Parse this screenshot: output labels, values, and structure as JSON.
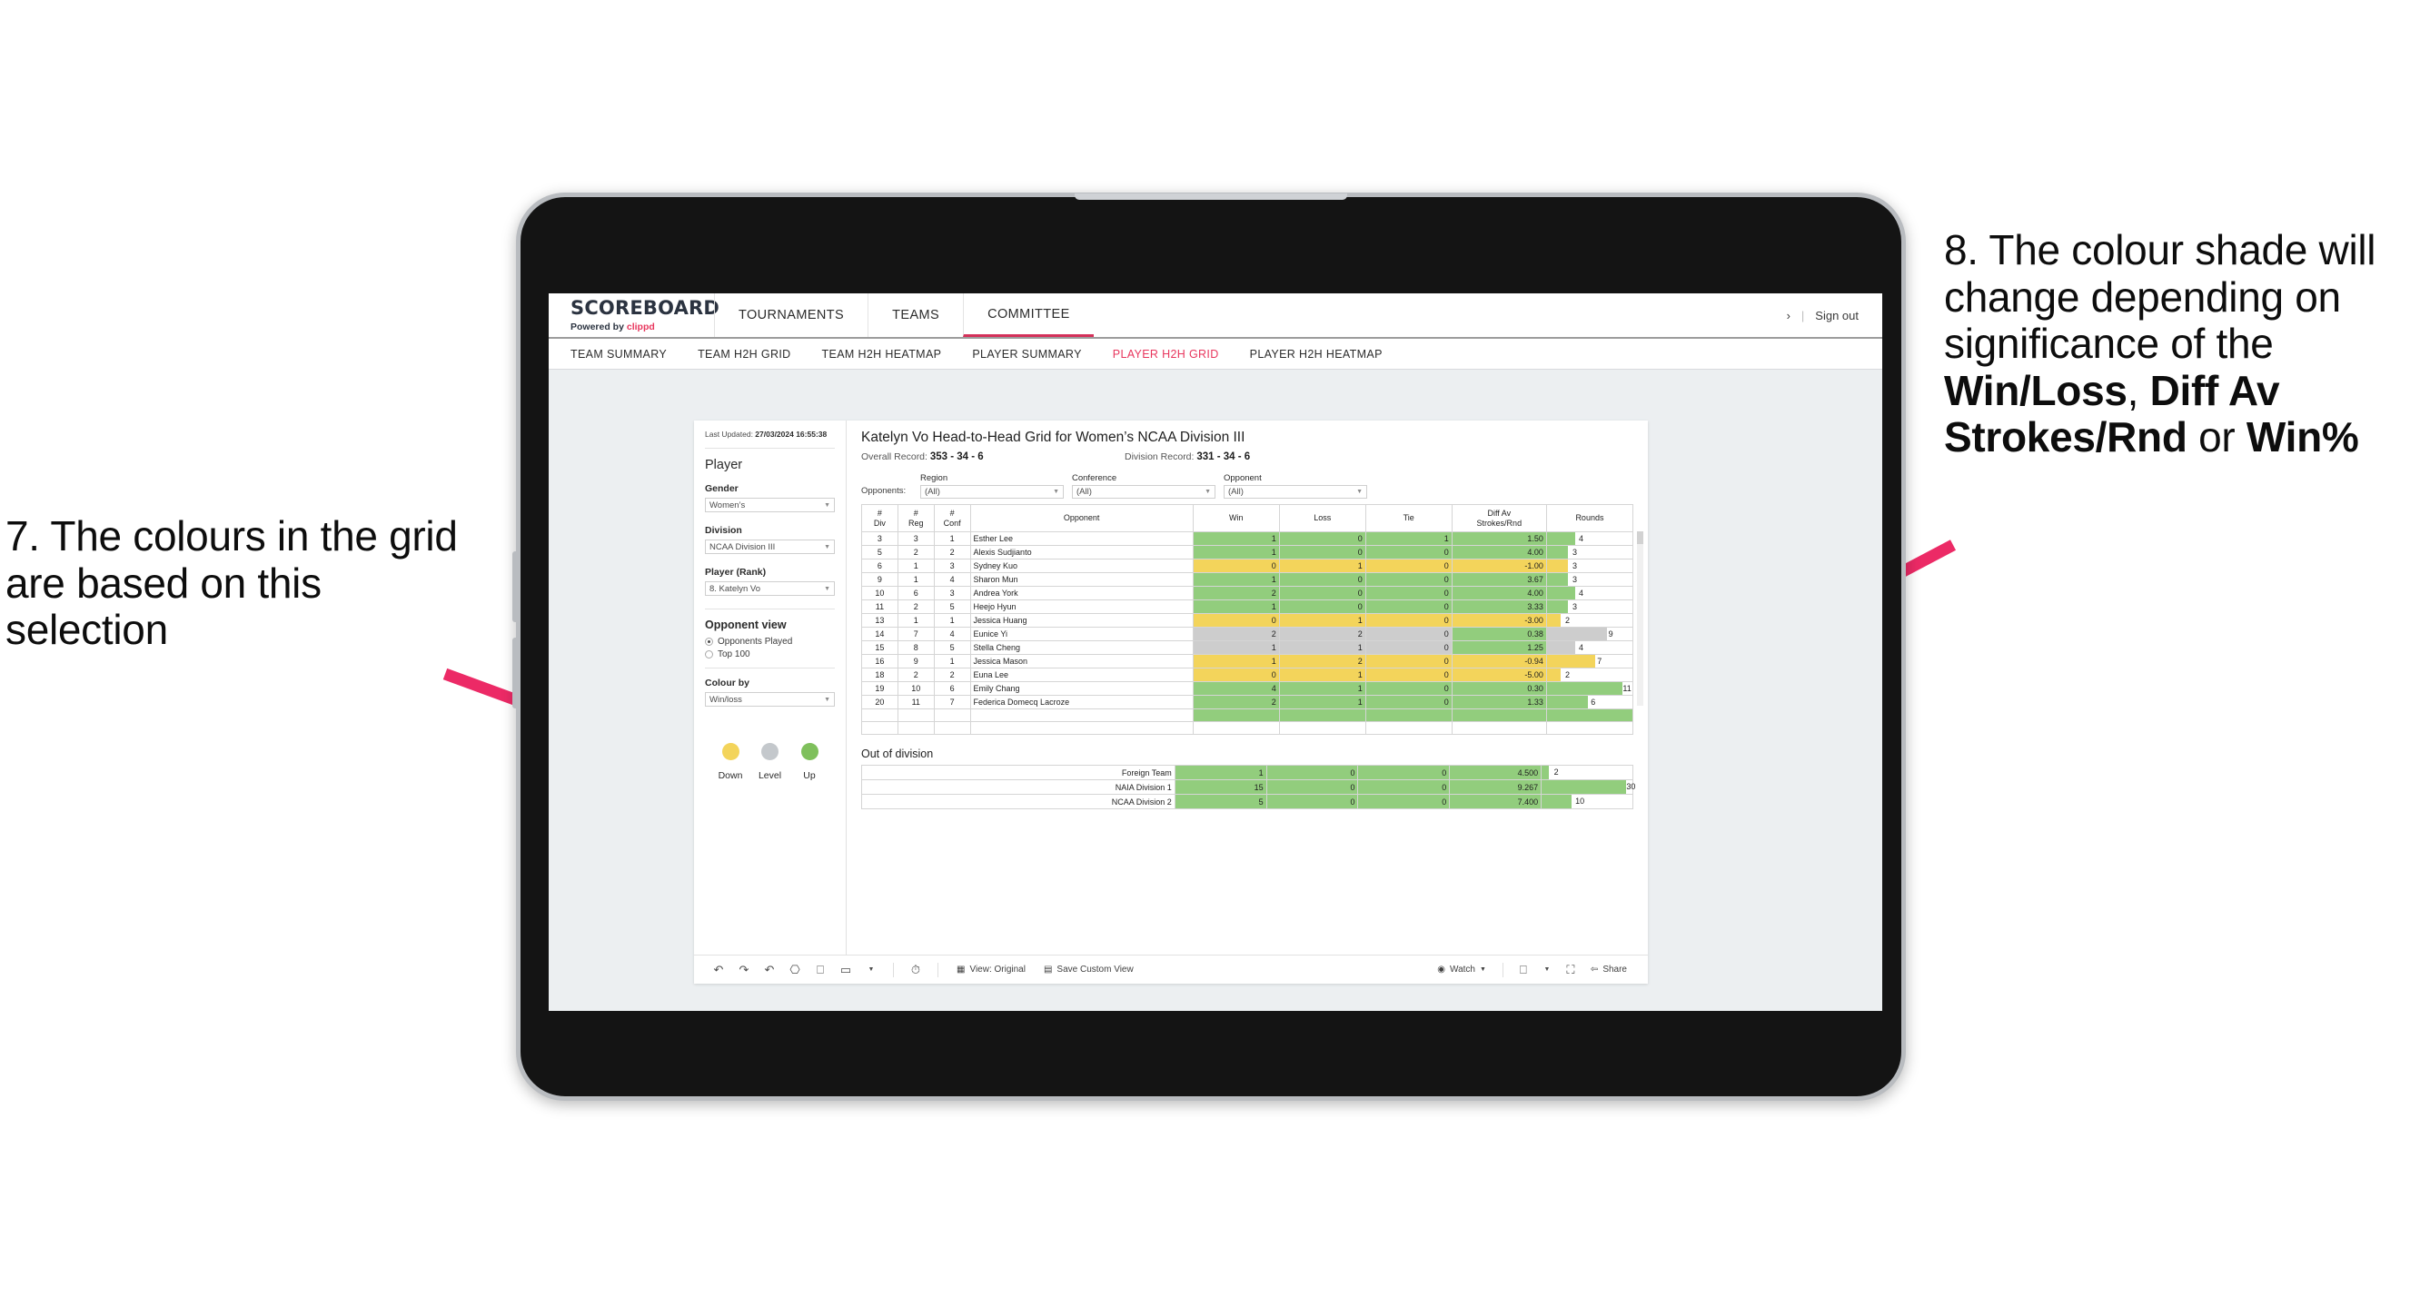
{
  "annotations": {
    "left": {
      "number": "7.",
      "text": "7. The colours in the grid are based on this selection"
    },
    "right": {
      "line1": "8. The colour shade will change depending on significance of the ",
      "bold1": "Win/Loss",
      "mid1": ", ",
      "bold2": "Diff Av Strokes/Rnd",
      "mid2": " or ",
      "bold3": "Win%"
    }
  },
  "app": {
    "brand": {
      "name": "SCOREBOARD",
      "powered_prefix": "Powered by ",
      "powered_brand": "clippd"
    },
    "top_nav": [
      {
        "label": "TOURNAMENTS",
        "active": false
      },
      {
        "label": "TEAMS",
        "active": false
      },
      {
        "label": "COMMITTEE",
        "active": true
      }
    ],
    "top_right": {
      "chevron": "›",
      "divider": "|",
      "sign_out": "Sign out"
    },
    "sub_nav": [
      {
        "label": "TEAM SUMMARY",
        "active": false
      },
      {
        "label": "TEAM H2H GRID",
        "active": false
      },
      {
        "label": "TEAM H2H HEATMAP",
        "active": false
      },
      {
        "label": "PLAYER SUMMARY",
        "active": false
      },
      {
        "label": "PLAYER H2H GRID",
        "active": true
      },
      {
        "label": "PLAYER H2H HEATMAP",
        "active": false
      }
    ]
  },
  "panel": {
    "last_updated_label": "Last Updated: ",
    "last_updated_value": "27/03/2024 16:55:38",
    "section_player": "Player",
    "gender": {
      "label": "Gender",
      "value": "Women’s"
    },
    "division": {
      "label": "Division",
      "value": "NCAA Division III"
    },
    "player_rank": {
      "label": "Player (Rank)",
      "value": "8. Katelyn Vo"
    },
    "opponent_view": {
      "label": "Opponent view",
      "options": [
        {
          "label": "Opponents Played",
          "selected": true
        },
        {
          "label": "Top 100",
          "selected": false
        }
      ]
    },
    "colour_by": {
      "label": "Colour by",
      "value": "Win/loss"
    },
    "legend": [
      {
        "label": "Down",
        "color": "#f3d45b"
      },
      {
        "label": "Level",
        "color": "#c4c8cc"
      },
      {
        "label": "Up",
        "color": "#7fc05c"
      }
    ]
  },
  "main": {
    "title": "Katelyn Vo Head-to-Head Grid for Women’s NCAA Division III",
    "overall_label": "Overall Record: ",
    "overall_value": "353 - 34 - 6",
    "division_label": "Division Record: ",
    "division_value": "331 - 34 - 6",
    "opponents_label": "Opponents:",
    "filters": [
      {
        "label": "Region",
        "value": "(All)"
      },
      {
        "label": "Conference",
        "value": "(All)"
      },
      {
        "label": "Opponent",
        "value": "(All)"
      }
    ],
    "columns": [
      {
        "line1": "#",
        "line2": "Div"
      },
      {
        "line1": "#",
        "line2": "Reg"
      },
      {
        "line1": "#",
        "line2": "Conf"
      },
      {
        "line1": "Opponent",
        "line2": ""
      },
      {
        "line1": "Win",
        "line2": ""
      },
      {
        "line1": "Loss",
        "line2": ""
      },
      {
        "line1": "Tie",
        "line2": ""
      },
      {
        "line1": "Diff Av",
        "line2": "Strokes/Rnd"
      },
      {
        "line1": "Rounds",
        "line2": ""
      }
    ],
    "out_of_division_title": "Out of division"
  },
  "chart_data": {
    "type": "table",
    "title": "Katelyn Vo Head-to-Head Grid for Women’s NCAA Division III",
    "columns": [
      "# Div",
      "# Reg",
      "# Conf",
      "Opponent",
      "Win",
      "Loss",
      "Tie",
      "Diff Av Strokes/Rnd",
      "Rounds"
    ],
    "colour_scale": {
      "up": "#92cd7d",
      "down": "#f3d45b",
      "level": "#cdcdcd"
    },
    "rows": [
      {
        "div": "3",
        "reg": "3",
        "conf": "1",
        "opponent": "Esther Lee",
        "win": "1",
        "loss": "0",
        "tie": "1",
        "diff": "1.50",
        "rounds": "4",
        "state": "g",
        "rnd_pct": 33
      },
      {
        "div": "5",
        "reg": "2",
        "conf": "2",
        "opponent": "Alexis Sudjianto",
        "win": "1",
        "loss": "0",
        "tie": "0",
        "diff": "4.00",
        "rounds": "3",
        "state": "g",
        "rnd_pct": 25
      },
      {
        "div": "6",
        "reg": "1",
        "conf": "3",
        "opponent": "Sydney Kuo",
        "win": "0",
        "loss": "1",
        "tie": "0",
        "diff": "-1.00",
        "rounds": "3",
        "state": "y",
        "rnd_pct": 25
      },
      {
        "div": "9",
        "reg": "1",
        "conf": "4",
        "opponent": "Sharon Mun",
        "win": "1",
        "loss": "0",
        "tie": "0",
        "diff": "3.67",
        "rounds": "3",
        "state": "g",
        "rnd_pct": 25
      },
      {
        "div": "10",
        "reg": "6",
        "conf": "3",
        "opponent": "Andrea York",
        "win": "2",
        "loss": "0",
        "tie": "0",
        "diff": "4.00",
        "rounds": "4",
        "state": "g",
        "rnd_pct": 33
      },
      {
        "div": "11",
        "reg": "2",
        "conf": "5",
        "opponent": "Heejo Hyun",
        "win": "1",
        "loss": "0",
        "tie": "0",
        "diff": "3.33",
        "rounds": "3",
        "state": "g",
        "rnd_pct": 25
      },
      {
        "div": "13",
        "reg": "1",
        "conf": "1",
        "opponent": "Jessica Huang",
        "win": "0",
        "loss": "1",
        "tie": "0",
        "diff": "-3.00",
        "rounds": "2",
        "state": "y",
        "rnd_pct": 16
      },
      {
        "div": "14",
        "reg": "7",
        "conf": "4",
        "opponent": "Eunice Yi",
        "win": "2",
        "loss": "2",
        "tie": "0",
        "diff": "0.38",
        "rounds": "9",
        "state": "n",
        "rnd_pct": 70,
        "diff_state": "g"
      },
      {
        "div": "15",
        "reg": "8",
        "conf": "5",
        "opponent": "Stella Cheng",
        "win": "1",
        "loss": "1",
        "tie": "0",
        "diff": "1.25",
        "rounds": "4",
        "state": "n",
        "rnd_pct": 33,
        "diff_state": "g"
      },
      {
        "div": "16",
        "reg": "9",
        "conf": "1",
        "opponent": "Jessica Mason",
        "win": "1",
        "loss": "2",
        "tie": "0",
        "diff": "-0.94",
        "rounds": "7",
        "state": "y",
        "rnd_pct": 56
      },
      {
        "div": "18",
        "reg": "2",
        "conf": "2",
        "opponent": "Euna Lee",
        "win": "0",
        "loss": "1",
        "tie": "0",
        "diff": "-5.00",
        "rounds": "2",
        "state": "y",
        "rnd_pct": 16
      },
      {
        "div": "19",
        "reg": "10",
        "conf": "6",
        "opponent": "Emily Chang",
        "win": "4",
        "loss": "1",
        "tie": "0",
        "diff": "0.30",
        "rounds": "11",
        "state": "g",
        "rnd_pct": 88
      },
      {
        "div": "20",
        "reg": "11",
        "conf": "7",
        "opponent": "Federica Domecq Lacroze",
        "win": "2",
        "loss": "1",
        "tie": "0",
        "diff": "1.33",
        "rounds": "6",
        "state": "g",
        "rnd_pct": 48
      }
    ],
    "out_of_division": [
      {
        "name": "Foreign Team",
        "win": "1",
        "loss": "0",
        "tie": "0",
        "diff": "4.500",
        "rounds": "2",
        "state": "g",
        "rnd_pct": 8
      },
      {
        "name": "NAIA Division 1",
        "win": "15",
        "loss": "0",
        "tie": "0",
        "diff": "9.267",
        "rounds": "30",
        "state": "g",
        "rnd_pct": 93
      },
      {
        "name": "NCAA Division 2",
        "win": "5",
        "loss": "0",
        "tie": "0",
        "diff": "7.400",
        "rounds": "10",
        "state": "g",
        "rnd_pct": 33
      }
    ]
  },
  "toolbar": {
    "icons": [
      "undo-icon",
      "redo-icon",
      "revert-icon",
      "refresh-icon",
      "pause-icon",
      "shape-icon",
      "caret-icon",
      "clock-icon"
    ],
    "view_original": "View: Original",
    "save_custom_view": "Save Custom View",
    "watch": "Watch",
    "share": "Share"
  }
}
